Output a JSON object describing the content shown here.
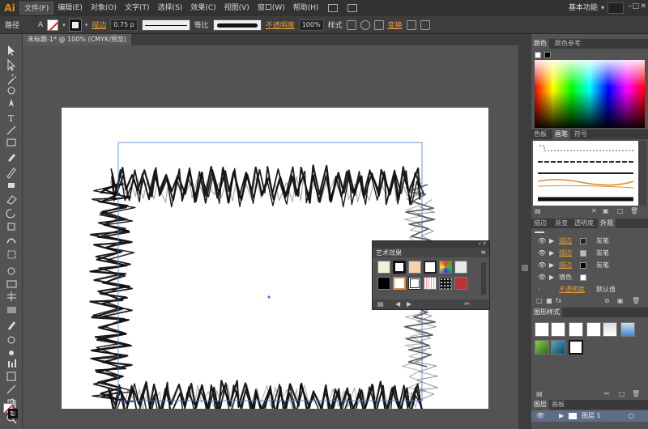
{
  "app": {
    "logo": "Ai",
    "workspace": "基本功能"
  },
  "menu": [
    "文件(F)",
    "编辑(E)",
    "对象(O)",
    "文字(T)",
    "选择(S)",
    "效果(C)",
    "视图(V)",
    "窗口(W)",
    "帮助(H)"
  ],
  "control": {
    "object_type": "路径",
    "stroke_link": "描边",
    "stroke_weight": "0.75 p",
    "profile_label": "等比",
    "opacity_link": "不透明度",
    "opacity_value": "100%",
    "style_label": "样式",
    "transform_link": "变换"
  },
  "document": {
    "tab_label": "未标题-1* @ 100% (CMYK/预览)"
  },
  "art_effects": {
    "title": "艺术效果"
  },
  "panels": {
    "color_tabs": [
      "颜色",
      "颜色参考"
    ],
    "swatch_tabs": [
      "色板",
      "画笔",
      "符号"
    ],
    "appearance_tabs": [
      "描边",
      "渐变",
      "透明度",
      "外观"
    ],
    "appearance_rows": [
      {
        "name": "描边",
        "value": "炭笔"
      },
      {
        "name": "描边",
        "value": "炭笔"
      },
      {
        "name": "描边",
        "value": "炭笔"
      },
      {
        "name": "填色",
        "value": ""
      },
      {
        "name": "不透明度",
        "value": "默认值"
      }
    ],
    "graphic_styles_tab": "图形样式",
    "layers_tabs": [
      "图层",
      "画板"
    ],
    "layer_name": "图层 1"
  },
  "colors": {
    "accent": "#e89b3a",
    "bg": "#535353"
  }
}
